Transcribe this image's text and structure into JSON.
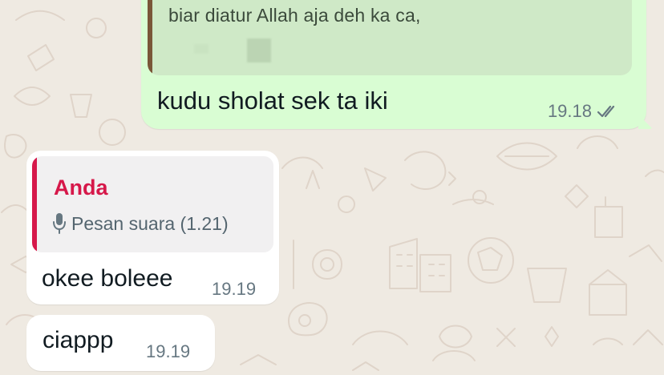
{
  "chat": {
    "outgoing": {
      "quote_text": "biar diatur Allah aja deh ka ca,",
      "message": "kudu sholat sek ta iki",
      "time": "19.18",
      "status_icon": "double-check-icon"
    },
    "incoming": [
      {
        "quote_sender": "Anda",
        "quote_icon": "microphone-icon",
        "quote_text": "Pesan suara (1.21)",
        "message": "okee boleee",
        "time": "19.19"
      },
      {
        "message": "ciappp",
        "time": "19.19"
      }
    ]
  },
  "colors": {
    "background": "#efeae2",
    "outgoing_bubble": "#d9fdd3",
    "incoming_bubble": "#ffffff",
    "sender_accent": "#d6184a",
    "quote_bar_outgoing": "#7a5638"
  }
}
